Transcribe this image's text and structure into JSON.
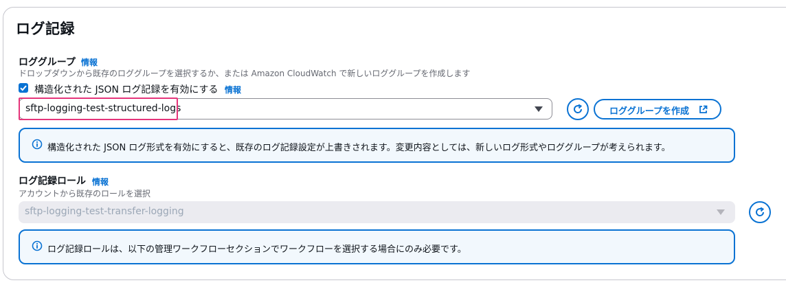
{
  "section": {
    "title": "ログ記録"
  },
  "log_group": {
    "label": "ロググループ",
    "info": "情報",
    "description": "ドロップダウンから既存のロググループを選択するか、または Amazon CloudWatch で新しいロググループを作成します",
    "checkbox": {
      "checked": true,
      "label": "構造化された JSON ログ記録を有効にする",
      "info": "情報"
    },
    "select_value": "sftp-logging-test-structured-logs",
    "create_button": "ロググループを作成",
    "alert": "構造化された JSON ログ形式を有効にすると、既存のログ記録設定が上書きされます。変更内容としては、新しいログ形式やロググループが考えられます。"
  },
  "log_role": {
    "label": "ログ記録ロール",
    "info": "情報",
    "description": "アカウントから既存のロールを選択",
    "select_value": "sftp-logging-test-transfer-logging",
    "alert": "ログ記録ロールは、以下の管理ワークフローセクションでワークフローを選択する場合にのみ必要です。"
  },
  "colors": {
    "accent": "#0972d3",
    "highlight": "#e5347a",
    "alert_bg": "#f2f8fd"
  },
  "icons": [
    "checkmark-icon",
    "caret-down-icon",
    "refresh-icon",
    "external-link-icon",
    "info-icon"
  ]
}
